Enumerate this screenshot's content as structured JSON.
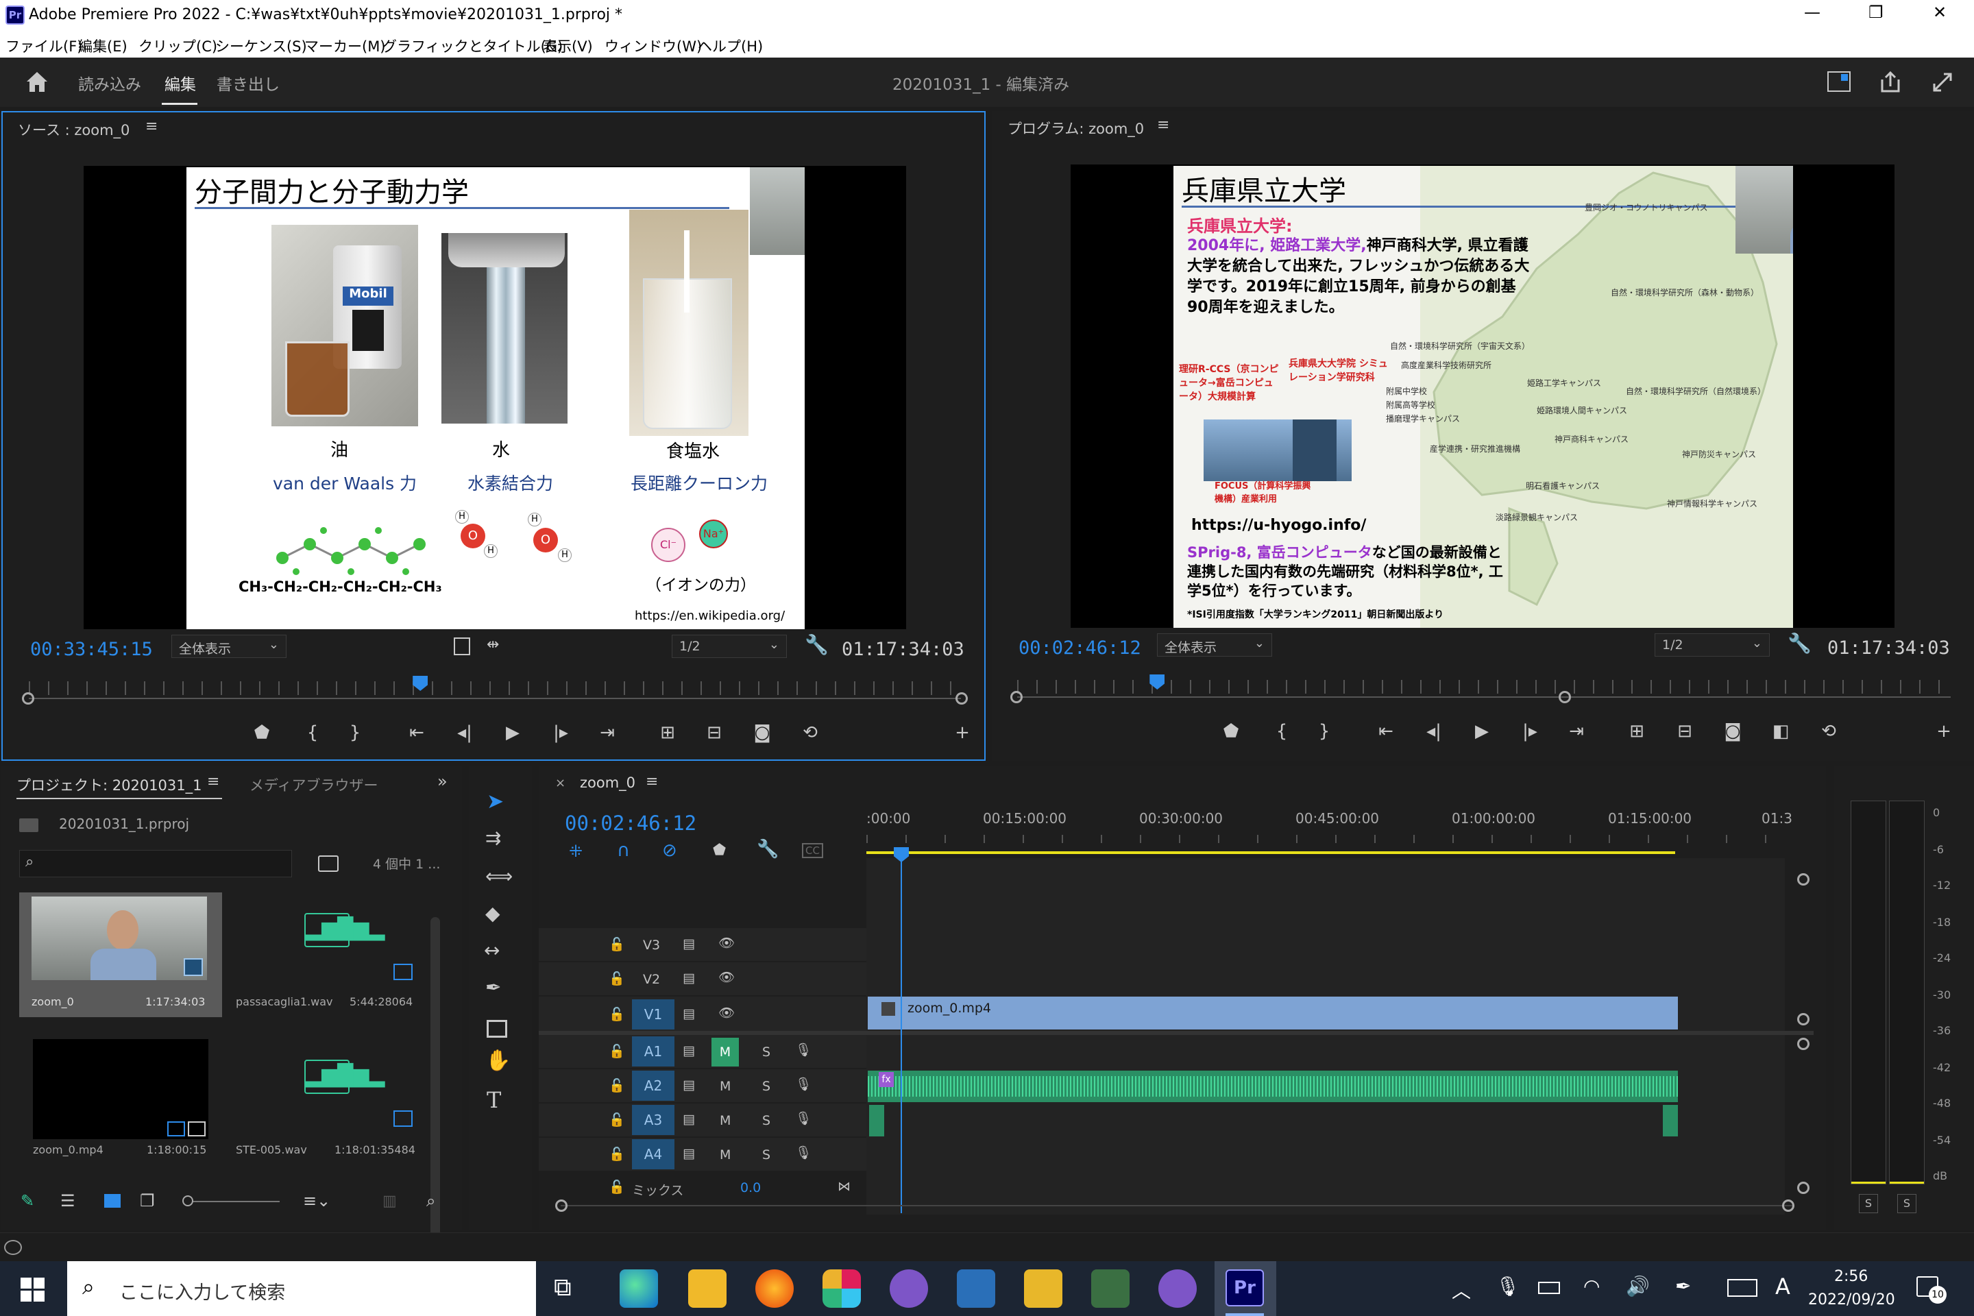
{
  "window": {
    "title": "Adobe Premiere Pro 2022 - C:¥was¥txt¥0uh¥ppts¥movie¥20201031_1.prproj *",
    "app_icon": "Pr",
    "controls": {
      "minimize": "—",
      "restore": "❐",
      "close": "✕"
    }
  },
  "menu": [
    "ファイル(F)",
    "編集(E)",
    "クリップ(C)",
    "シーケンス(S)",
    "マーカー(M)",
    "グラフィックとタイトル(G)",
    "表示(V)",
    "ウィンドウ(W)",
    "ヘルプ(H)"
  ],
  "header": {
    "tabs": [
      "読み込み",
      "編集",
      "書き出し"
    ],
    "active_tab": "編集",
    "center_title": "20201031_1 - 編集済み"
  },
  "source": {
    "title": "ソース : zoom_0",
    "timecode": "00:33:45:15",
    "zoom": "全体表示",
    "quality": "1/2",
    "duration": "01:17:34:03",
    "playhead_progress": 0.42
  },
  "program": {
    "title": "プログラム: zoom_0",
    "timecode": "00:02:46:12",
    "zoom": "全体表示",
    "quality": "1/2",
    "duration": "01:17:34:03",
    "playhead_progress": 0.15
  },
  "slide_left": {
    "title": "分子間力と分子動力学",
    "items": [
      {
        "name": "油",
        "sub": "van der Waals 力"
      },
      {
        "name": "水",
        "sub": "水素結合力"
      },
      {
        "name": "食塩水",
        "sub": "長距離クーロン力"
      }
    ],
    "formula": "CH₃-CH₂-CH₂-CH₂-CH₂-CH₃",
    "ion_note": "（イオンの力）",
    "url": "https://en.wikipedia.org/",
    "oil_label": "Mobil",
    "h": "H",
    "o": "O",
    "cl": "Cl⁻",
    "na": "Na⁺"
  },
  "slide_right": {
    "title": "兵庫県立大学",
    "heading": "兵庫県立大学:",
    "para1_red": "2004年に, 姫路工業大学,",
    "para1": "神戸商科大学, 県立看護大学を統合して出来た, フレッシュかつ伝統ある大学です。2019年に創立15周年, 前身からの創基90周年を迎えました。",
    "riken": "理研R-CCS（京コンピュータ→富岳コンピュータ）大規模計算",
    "hyogo_sim": "兵庫県大大学院 シミュレーション学研究科",
    "focus": "FOCUS（計算科学振興機構）産業利用",
    "url": "https://u-hyogo.info/",
    "spring_red": "SPrig-8, 富岳コンピュータ",
    "spring": "など国の最新設備と連携した国内有数の先端研究（材料科学8位*, 工学5位*）を行っています。",
    "footnote": "*ISI引用度指数「大学ランキング2011」朝日新聞出版より",
    "campuses": [
      "豊岡ジオ・コウノトリキャンパス",
      "自然・環境科学研究所（森林・動物系）",
      "自然・環境科学研究所（宇宙天文系）",
      "高度産業科学技術研究所",
      "姫路工学キャンパス",
      "自然・環境科学研究所（自然環境系）",
      "附属中学校",
      "附属高等学校",
      "播磨理学キャンパス",
      "姫路環境人間キャンパス",
      "神戸商科キャンパス",
      "産学連携・研究推進機構",
      "神戸防災キャンパス",
      "明石看護キャンパス",
      "神戸情報科学キャンパス",
      "淡路緑景観キャンパス"
    ]
  },
  "project": {
    "tab": "プロジェクト: 20201031_1",
    "tab2": "メディアブラウザー",
    "file": "20201031_1.prproj",
    "count": "4 個中 1 ...",
    "items": [
      {
        "name": "zoom_0",
        "dur": "1:17:34:03"
      },
      {
        "name": "passacaglia1.wav",
        "dur": "5:44:28064"
      },
      {
        "name": "zoom_0.mp4",
        "dur": "1:18:00:15"
      },
      {
        "name": "STE-005.wav",
        "dur": "1:18:01:35484"
      }
    ]
  },
  "timeline": {
    "tab": "zoom_0",
    "timecode": "00:02:46:12",
    "ruler": [
      ":00:00",
      "00:15:00:00",
      "00:30:00:00",
      "00:45:00:00",
      "01:00:00:00",
      "01:15:00:00",
      "01:3"
    ],
    "tracks_v": [
      "V3",
      "V2",
      "V1"
    ],
    "tracks_a": [
      "A1",
      "A2",
      "A3",
      "A4"
    ],
    "mix": "ミックス",
    "mix_val": "0.0",
    "clip": "zoom_0.mp4",
    "m": "M",
    "s": "S",
    "fx": "fx",
    "cc": "CC"
  },
  "meter": {
    "labels": [
      "0",
      "-6",
      "-12",
      "-18",
      "-24",
      "-30",
      "-36",
      "-42",
      "-48",
      "-54",
      "dB"
    ],
    "s": "S"
  },
  "taskbar": {
    "search": "ここに入力して検索",
    "time": "2:56",
    "date": "2022/09/20",
    "ime": "A",
    "notif": "10",
    "pr": "Pr"
  }
}
